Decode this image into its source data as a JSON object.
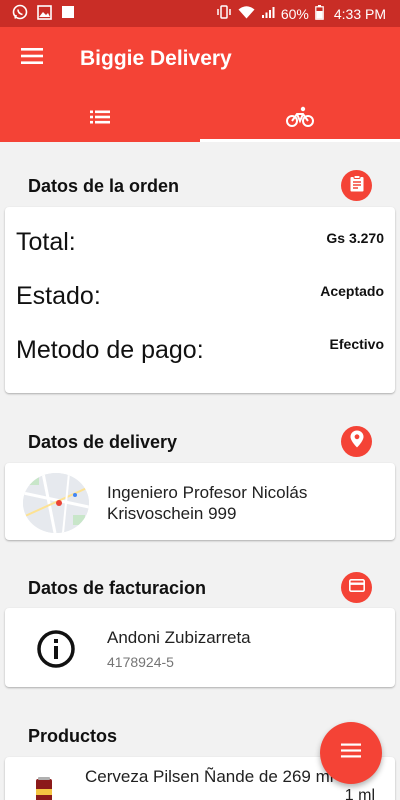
{
  "status_bar": {
    "battery_percent": "60%",
    "time": "4:33 PM",
    "left_icons": [
      "whatsapp-icon",
      "image-icon",
      "square-icon"
    ],
    "right_icons": [
      "vibrate-icon",
      "wifi-icon",
      "signal-icon",
      "battery-icon"
    ]
  },
  "app_bar": {
    "title": "Biggie Delivery",
    "menu_icon": "hamburger-menu-icon",
    "tabs": [
      {
        "icon": "list-icon",
        "selected": false
      },
      {
        "icon": "bicycle-icon",
        "selected": true
      }
    ]
  },
  "order": {
    "header": "Datos de la orden",
    "header_icon": "clipboard-icon",
    "rows": [
      {
        "label": "Total:",
        "value": "Gs 3.270"
      },
      {
        "label": "Estado:",
        "value": "Aceptado"
      },
      {
        "label": "Metodo de pago:",
        "value": "Efectivo"
      }
    ]
  },
  "delivery": {
    "header": "Datos de delivery",
    "header_icon": "location-pin-icon",
    "address": "Ingeniero Profesor Nicolás Krisvoschein 999"
  },
  "billing": {
    "header": "Datos de facturacion",
    "header_icon": "credit-card-icon",
    "name": "Andoni Zubizarreta",
    "ruc": "4178924-5"
  },
  "products": {
    "header": "Productos",
    "items": [
      {
        "name": "Cerveza Pilsen Ñande de 269 ml",
        "quantity": "1 ml"
      }
    ]
  },
  "fab": {
    "icon": "menu-icon"
  },
  "colors": {
    "primary": "#f44336",
    "status_bar": "#c92d26",
    "background": "#f2f2f2",
    "card": "#ffffff"
  }
}
